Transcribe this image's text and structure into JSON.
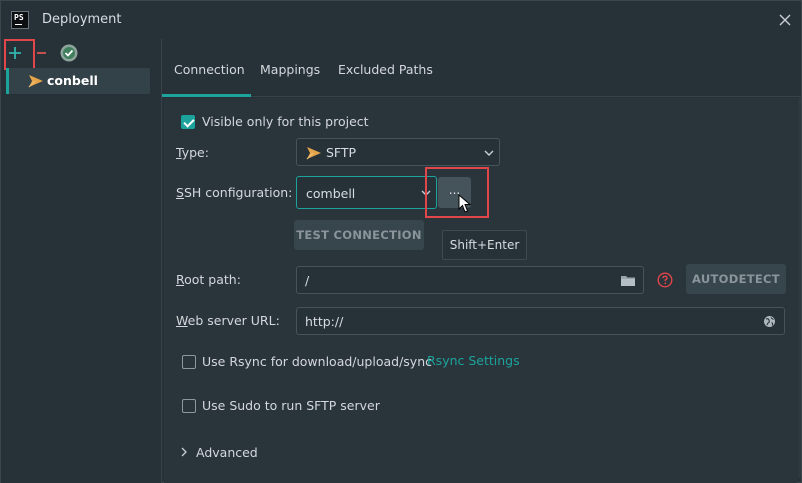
{
  "window": {
    "title": "Deployment",
    "app_logo_text": "PS"
  },
  "sidebar": {
    "toolbar": {
      "add_icon": "plus-icon",
      "remove_icon": "minus-icon",
      "check_icon": "check-circle-icon"
    },
    "servers": [
      {
        "label": "conbell",
        "icon": "sftp-server-icon"
      }
    ]
  },
  "tabs": [
    {
      "label": "Connection",
      "active": true
    },
    {
      "label": "Mappings",
      "active": false
    },
    {
      "label": "Excluded Paths",
      "active": false
    }
  ],
  "connection": {
    "visible_only_label": "Visible only for this project",
    "visible_only_checked": true,
    "type_label_u": "T",
    "type_label_rest": "ype:",
    "type_value": "SFTP",
    "ssh_label_u": "S",
    "ssh_label_rest": "SH configuration:",
    "ssh_value": "combell",
    "ellipsis_label": "...",
    "test_connection_label": "TEST CONNECTION",
    "tooltip": "Shift+Enter",
    "root_path_label_u": "R",
    "root_path_label_rest": "oot path:",
    "root_path_value": "/",
    "autodetect_label": "AUTODETECT",
    "web_url_label_u": "W",
    "web_url_label_rest": "eb server URL:",
    "web_url_value": "http://",
    "rsync_label": "Use Rsync for download/upload/sync",
    "rsync_checked": false,
    "rsync_settings_link": "Rsync Settings",
    "sudo_label": "Use Sudo to run SFTP server",
    "sudo_checked": false,
    "advanced_label": "Advanced"
  },
  "colors": {
    "accent": "#1ba39c",
    "highlight": "#e0464a",
    "background": "#263238",
    "panel": "#2a353b",
    "help_icon": "#e0464a"
  }
}
